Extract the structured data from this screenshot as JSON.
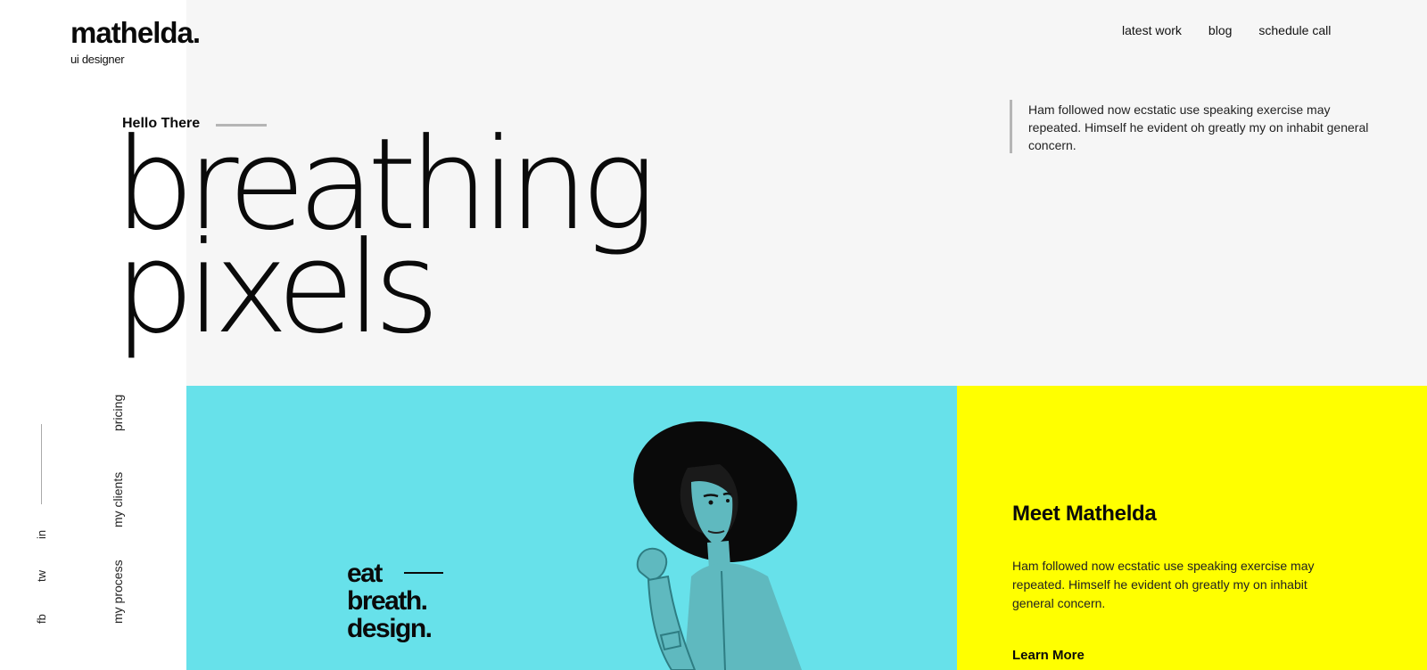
{
  "brand": {
    "logo": "mathelda.",
    "subtitle": "ui designer"
  },
  "nav": {
    "items": [
      {
        "label": "latest work"
      },
      {
        "label": "blog"
      },
      {
        "label": "schedule call"
      }
    ]
  },
  "hero": {
    "greeting": "Hello There",
    "title_line1": "breathing",
    "title_line2": "pixels",
    "quote": "Ham followed now ecstatic use speaking exercise may repeated. Himself he evident oh greatly my on inhabit general concern."
  },
  "social": {
    "items": [
      {
        "label": "in"
      },
      {
        "label": "tw"
      },
      {
        "label": "fb"
      }
    ]
  },
  "side_nav": {
    "items": [
      {
        "label": "pricing"
      },
      {
        "label": "my clients"
      },
      {
        "label": "my process"
      }
    ]
  },
  "feature": {
    "tagline_1": "eat",
    "tagline_2": "breath.",
    "tagline_3": "design."
  },
  "about": {
    "title": "Meet Mathelda",
    "text": "Ham followed now ecstatic use speaking exercise may repeated. Himself he evident oh greatly my on inhabit general concern.",
    "cta": "Learn More"
  },
  "colors": {
    "panel_grey": "#f6f6f6",
    "panel_cyan": "#67e1ea",
    "panel_yellow": "#ffff00",
    "text": "#0a0a0a",
    "rule": "#b5b5b5"
  }
}
